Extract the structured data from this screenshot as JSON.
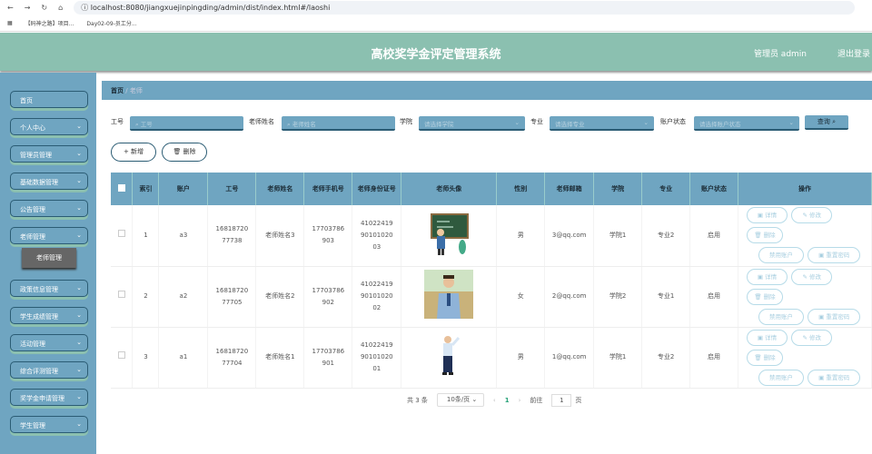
{
  "browser": {
    "url": "localhost:8080/jiangxuejinpingding/admin/dist/index.html#/laoshi",
    "bookmarks": [
      "【码神之路】项目...",
      "Day02-09-员工分..."
    ]
  },
  "header": {
    "title": "高校奖学金评定管理系统",
    "user": "管理员 admin",
    "logout": "退出登录"
  },
  "sidebar": {
    "items": [
      "首页",
      "个人中心",
      "管理员管理",
      "基础数据管理",
      "公告管理",
      "老师管理",
      "政策信息管理",
      "学生成绩管理",
      "活动管理",
      "综合评测管理",
      "奖学金申请管理",
      "学生管理"
    ],
    "submenu": "老师管理"
  },
  "breadcrumb": {
    "home": "首页",
    "current": "老师"
  },
  "filters": {
    "gonghao_label": "工号",
    "gonghao_ph": "工号",
    "name_label": "老师姓名",
    "name_ph": "老师姓名",
    "college_label": "学院",
    "college_ph": "请选择学院",
    "major_label": "专业",
    "major_ph": "请选择专业",
    "status_label": "账户状态",
    "status_ph": "请选择账户状态",
    "query": "查询 ⌕"
  },
  "actions": {
    "add": "+ 新增",
    "delete": "🗑 删除"
  },
  "table": {
    "headers": [
      "索引",
      "账户",
      "工号",
      "老师姓名",
      "老师手机号",
      "老师身份证号",
      "老师头像",
      "性别",
      "老师邮箱",
      "学院",
      "专业",
      "账户状态",
      "操作"
    ],
    "rows": [
      {
        "index": "1",
        "account": "a3",
        "gonghao": "1681872077738",
        "name": "老师姓名3",
        "phone": "17703786903",
        "idcard": "410224199010102003",
        "gender": "男",
        "email": "3@qq.com",
        "college": "学院1",
        "major": "专业2",
        "status": "启用"
      },
      {
        "index": "2",
        "account": "a2",
        "gonghao": "1681872077705",
        "name": "老师姓名2",
        "phone": "17703786902",
        "idcard": "410224199010102002",
        "gender": "女",
        "email": "2@qq.com",
        "college": "学院2",
        "major": "专业1",
        "status": "启用"
      },
      {
        "index": "3",
        "account": "a1",
        "gonghao": "1681872077704",
        "name": "老师姓名1",
        "phone": "17703786901",
        "idcard": "410224199010102001",
        "gender": "男",
        "email": "1@qq.com",
        "college": "学院1",
        "major": "专业2",
        "status": "启用"
      }
    ],
    "ops": {
      "detail": "详情",
      "edit": "修改",
      "delete": "删除",
      "disable": "禁用账户",
      "reset": "重置密码"
    }
  },
  "pagination": {
    "total": "共 3 条",
    "page_size": "10条/页",
    "current": "1",
    "goto_label": "前往",
    "goto_value": "1",
    "page_suffix": "页"
  }
}
